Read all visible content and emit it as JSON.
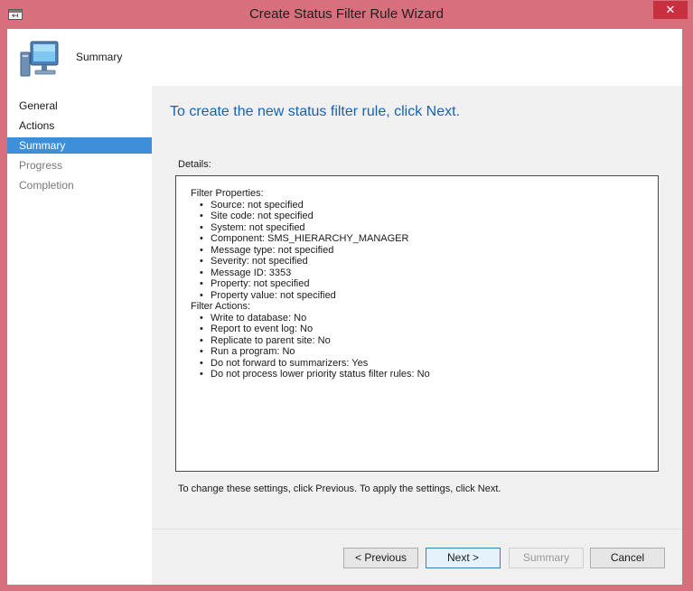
{
  "window": {
    "title": "Create Status Filter Rule Wizard",
    "close_glyph": "✕"
  },
  "header": {
    "title": "Summary",
    "icon": "computer-icon"
  },
  "nav": {
    "items": [
      {
        "label": "General"
      },
      {
        "label": "Actions"
      },
      {
        "label": "Summary"
      },
      {
        "label": "Progress"
      },
      {
        "label": "Completion"
      }
    ]
  },
  "content": {
    "heading": "To create the new status filter rule, click Next.",
    "details_label": "Details:",
    "filter_properties_title": "Filter Properties:",
    "filter_properties": [
      "Source: not specified",
      "Site code: not specified",
      "System: not specified",
      "Component: SMS_HIERARCHY_MANAGER",
      "Message type: not specified",
      "Severity: not specified",
      "Message ID: 3353",
      "Property: not specified",
      "Property value: not specified"
    ],
    "filter_actions_title": "Filter Actions:",
    "filter_actions": [
      "Write to database: No",
      "Report to event log: No",
      "Replicate to parent site: No",
      "Run a program: No",
      "Do not forward to summarizers: Yes",
      "Do not process lower priority status filter rules: No"
    ],
    "hint": "To change these settings, click Previous. To apply the settings, click Next."
  },
  "buttons": {
    "previous": "< Previous",
    "next": "Next >",
    "summary": "Summary",
    "cancel": "Cancel"
  },
  "colors": {
    "accent": "#3c8fd8",
    "heading": "#1664b0",
    "frame": "#d7707c",
    "close": "#c9303f"
  }
}
